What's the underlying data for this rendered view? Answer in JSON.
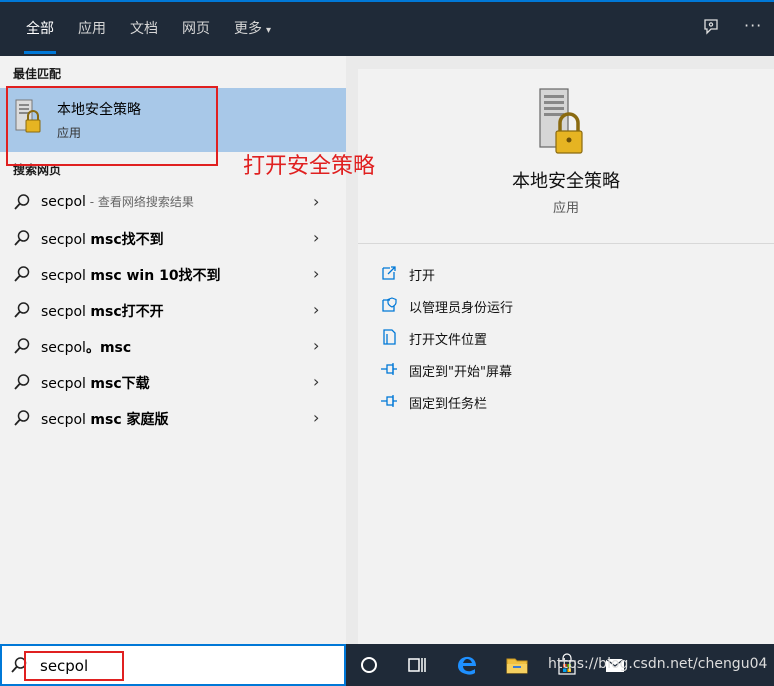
{
  "tabs": [
    {
      "label": "全部"
    },
    {
      "label": "应用"
    },
    {
      "label": "文档"
    },
    {
      "label": "网页"
    },
    {
      "label": "更多"
    }
  ],
  "more_caret": "▾",
  "top_icons": {
    "feedback": "feedback-icon",
    "more": "···"
  },
  "best_match": {
    "header": "最佳匹配",
    "name": "本地安全策略",
    "type": "应用"
  },
  "web_section": {
    "header": "搜索网页"
  },
  "suggestions": [
    {
      "query": "secpol",
      "rest": "",
      "sub": " - 查看网络搜索结果"
    },
    {
      "query": "secpol ",
      "rest": "msc找不到",
      "sub": ""
    },
    {
      "query": "secpol ",
      "rest": "msc win 10找不到",
      "sub": ""
    },
    {
      "query": "secpol ",
      "rest": "msc打不开",
      "sub": ""
    },
    {
      "query": "secpol",
      "rest": "。msc",
      "sub": ""
    },
    {
      "query": "secpol ",
      "rest": "msc下载",
      "sub": ""
    },
    {
      "query": "secpol ",
      "rest": "msc 家庭版",
      "sub": ""
    }
  ],
  "detail": {
    "title": "本地安全策略",
    "type": "应用",
    "actions": [
      {
        "label": "打开",
        "icon": "open-icon"
      },
      {
        "label": "以管理员身份运行",
        "icon": "admin-shield-icon"
      },
      {
        "label": "打开文件位置",
        "icon": "file-location-icon"
      },
      {
        "label": "固定到\"开始\"屏幕",
        "icon": "pin-icon"
      },
      {
        "label": "固定到任务栏",
        "icon": "pin-icon"
      }
    ]
  },
  "annotation": "打开安全策略",
  "search": {
    "value": "secpol"
  },
  "watermark": "https://blog.csdn.net/chengu04",
  "colors": {
    "accent": "#0078d7",
    "dark": "#1f2a38",
    "highlight": "#a8c8e8",
    "annotation": "#e02020"
  }
}
